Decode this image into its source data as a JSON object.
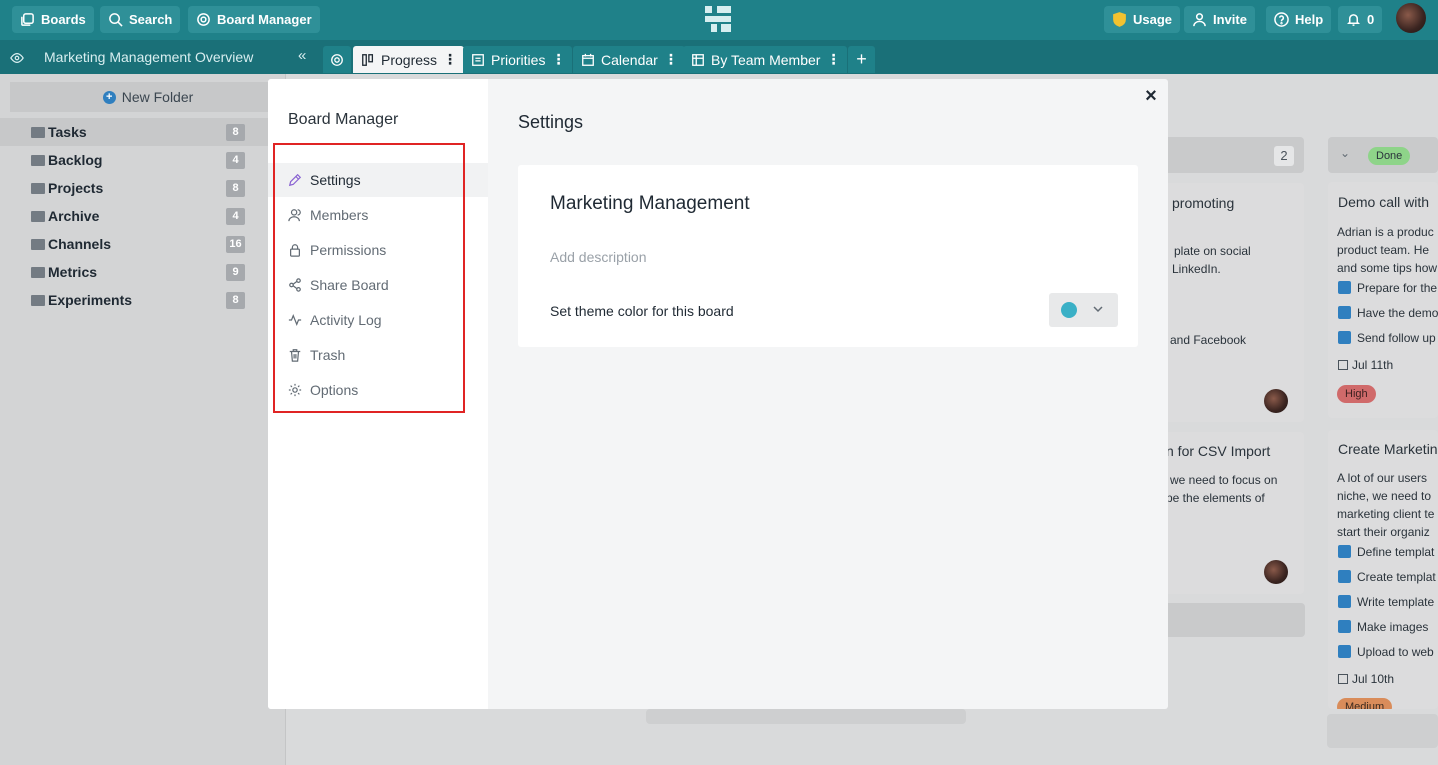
{
  "topbar": {
    "boards_label": "Boards",
    "search_label": "Search",
    "board_manager_label": "Board Manager",
    "usage_label": "Usage",
    "invite_label": "Invite",
    "help_label": "Help",
    "notifications_count": "0"
  },
  "tabbar": {
    "board_title": "Marketing Management Overview",
    "tabs": [
      {
        "label": "Progress"
      },
      {
        "label": "Priorities"
      },
      {
        "label": "Calendar"
      },
      {
        "label": "By Team Member"
      }
    ],
    "add_tab": "+"
  },
  "sidebar": {
    "new_folder_label": "New Folder",
    "folders": [
      {
        "name": "Tasks",
        "count": "8"
      },
      {
        "name": "Backlog",
        "count": "4"
      },
      {
        "name": "Projects",
        "count": "8"
      },
      {
        "name": "Archive",
        "count": "4"
      },
      {
        "name": "Channels",
        "count": "16"
      },
      {
        "name": "Metrics",
        "count": "9"
      },
      {
        "name": "Experiments",
        "count": "8"
      }
    ]
  },
  "background_board": {
    "column_count": "2",
    "done_label": "Done",
    "card1": {
      "title": "promoting",
      "line1": "plate on social",
      "line2": "LinkedIn.",
      "line3": "and Facebook"
    },
    "card2": {
      "title": "n for CSV Import",
      "line1": "we need to focus on",
      "line2": "pe the elements of"
    },
    "done_card1": {
      "title": "Demo call with",
      "body": [
        "Adrian is a produc",
        "product team. He",
        "and some tips how"
      ],
      "checks": [
        "Prepare for the",
        "Have the demo",
        "Send follow up"
      ],
      "date": "Jul 11th",
      "priority": "High"
    },
    "done_card2": {
      "title": "Create Marketin",
      "body": [
        "A lot of our users",
        "niche, we need to",
        "marketing client te",
        "start their organiz"
      ],
      "checks": [
        "Define templat",
        "Create templat",
        "Write template",
        "Make images",
        "Upload to web"
      ],
      "date": "Jul 10th",
      "priority": "Medium"
    }
  },
  "modal": {
    "heading": "Board Manager",
    "menu": [
      {
        "label": "Settings",
        "icon": "pencil-icon"
      },
      {
        "label": "Members",
        "icon": "users-icon"
      },
      {
        "label": "Permissions",
        "icon": "lock-icon"
      },
      {
        "label": "Share Board",
        "icon": "share-icon"
      },
      {
        "label": "Activity Log",
        "icon": "activity-icon"
      },
      {
        "label": "Trash",
        "icon": "trash-icon"
      },
      {
        "label": "Options",
        "icon": "gear-icon"
      }
    ],
    "close_label": "×",
    "settings": {
      "title": "Settings",
      "board_name": "Marketing Management",
      "description_placeholder": "Add description",
      "theme_label": "Set theme color for this board",
      "theme_color": "#3ab0c6"
    }
  },
  "colors": {
    "topbar": "#1f8189",
    "tabbar": "#1a7078",
    "highlight": "#e02424",
    "active_icon": "#8a63d2"
  }
}
